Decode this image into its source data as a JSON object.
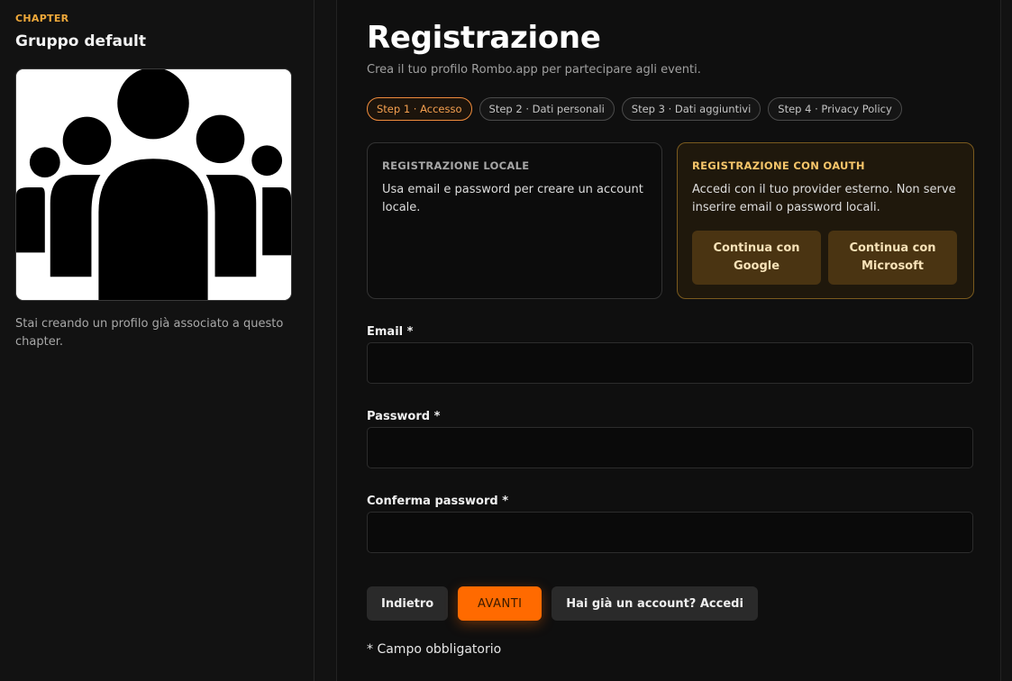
{
  "sidebar": {
    "eyebrow": "CHAPTER",
    "group_name": "Gruppo default",
    "image_icon": "group-people-icon",
    "note": "Stai creando un profilo già associato a questo chapter."
  },
  "main": {
    "title": "Registrazione",
    "subtitle": "Crea il tuo profilo Rombo.app per partecipare agli eventi.",
    "steps": [
      {
        "label": "Step 1 · Accesso",
        "active": true
      },
      {
        "label": "Step 2 · Dati personali",
        "active": false
      },
      {
        "label": "Step 3 · Dati aggiuntivi",
        "active": false
      },
      {
        "label": "Step 4 · Privacy Policy",
        "active": false
      }
    ],
    "local_card": {
      "title": "REGISTRAZIONE LOCALE",
      "desc": "Usa email e password per creare un account locale."
    },
    "oauth_card": {
      "title": "REGISTRAZIONE CON OAUTH",
      "desc": "Accedi con il tuo provider esterno. Non serve inserire email o password locali.",
      "google_label": "Continua con Google",
      "microsoft_label": "Continua con Microsoft"
    },
    "fields": {
      "email_label": "Email *",
      "email_value": "",
      "password_label": "Password *",
      "password_value": "",
      "confirm_label": "Conferma password *",
      "confirm_value": ""
    },
    "actions": {
      "back_label": "Indietro",
      "next_label": "AVANTI",
      "login_label": "Hai già un account? Accedi"
    },
    "footnote": "* Campo obbligatorio"
  },
  "colors": {
    "accent": "#ff6a00",
    "oauth_gold": "#f5c56a",
    "eyebrow": "#f0a93a"
  }
}
